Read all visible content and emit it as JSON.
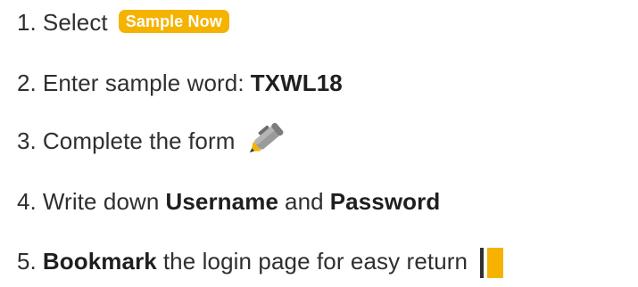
{
  "steps": [
    {
      "number": "1.",
      "text_before": "Select",
      "badge_label": "Sample Now"
    },
    {
      "number": "2.",
      "text_before": "Enter sample word:",
      "bold": "TXWL18"
    },
    {
      "number": "3.",
      "text_before": "Complete the form",
      "icon": "pen-icon"
    },
    {
      "number": "4.",
      "text_before": "Write down",
      "bold_1": "Username",
      "middle": "and",
      "bold_2": "Password"
    },
    {
      "number": "5.",
      "bold": "Bookmark",
      "text_after": "the login page for easy return",
      "icon": "bookmark-icon"
    }
  ],
  "colors": {
    "accent": "#f5b300",
    "text": "#2f2f2f",
    "background": "#ffffff"
  }
}
